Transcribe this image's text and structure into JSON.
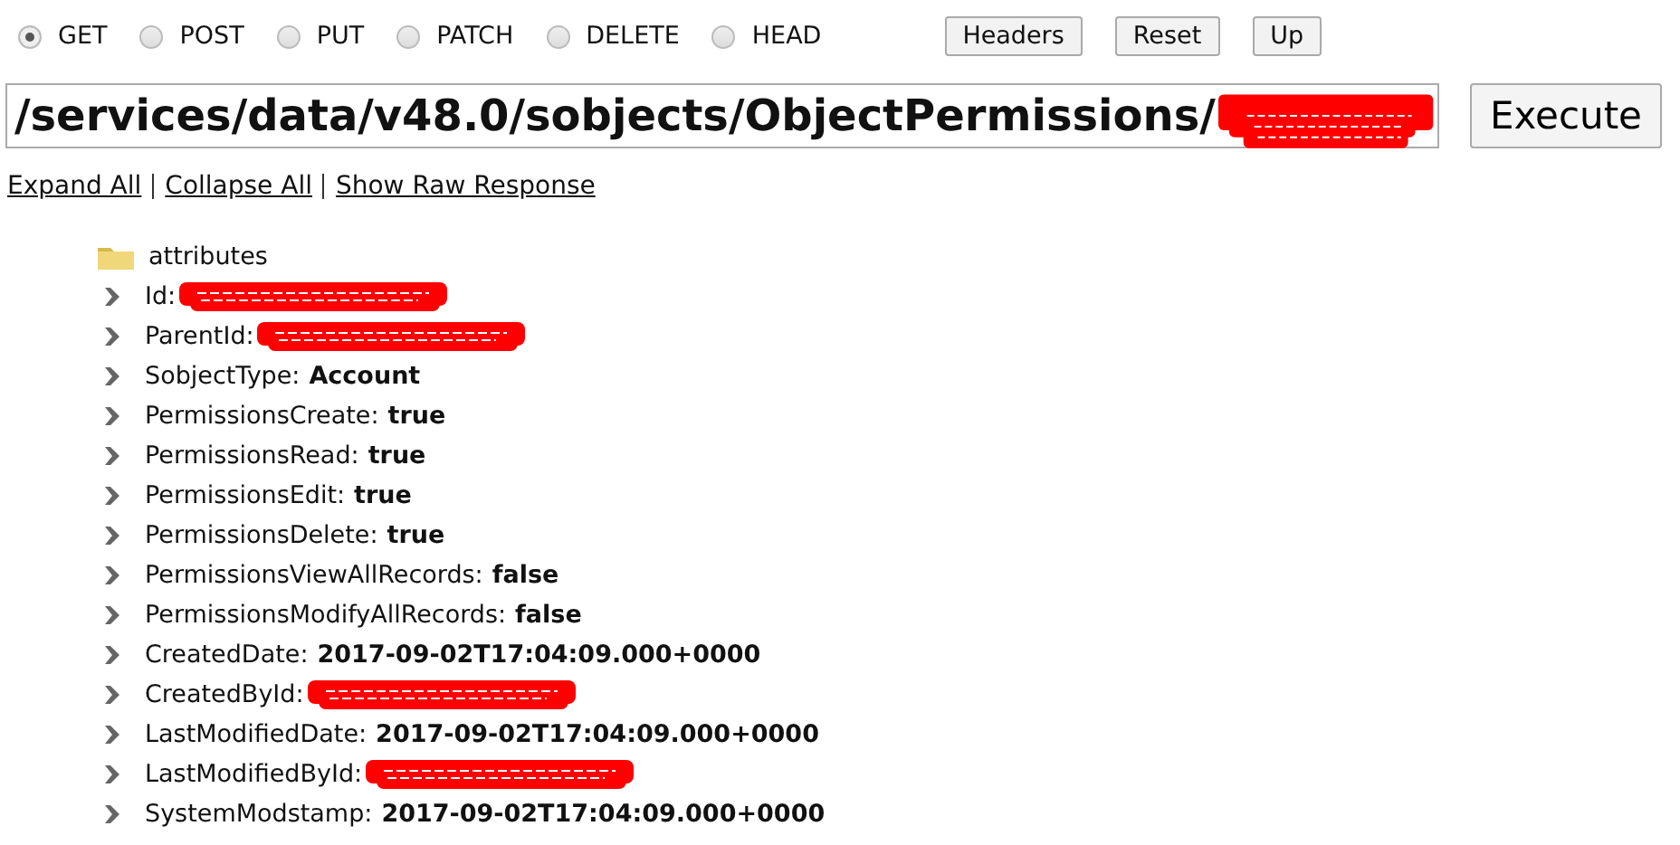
{
  "methods": [
    {
      "label": "GET",
      "selected": true
    },
    {
      "label": "POST",
      "selected": false
    },
    {
      "label": "PUT",
      "selected": false
    },
    {
      "label": "PATCH",
      "selected": false
    },
    {
      "label": "DELETE",
      "selected": false
    },
    {
      "label": "HEAD",
      "selected": false
    }
  ],
  "toolbar_buttons": [
    "Headers",
    "Reset",
    "Up"
  ],
  "url": {
    "value": "/services/data/v48.0/sobjects/ObjectPermissions/",
    "redacted": true
  },
  "execute_button": "Execute",
  "links": [
    "Expand All",
    "Collapse All",
    "Show Raw Response"
  ],
  "tree": [
    {
      "kind": "folder",
      "label": "attributes"
    },
    {
      "kind": "field",
      "label": "Id:",
      "redacted": true
    },
    {
      "kind": "field",
      "label": "ParentId:",
      "redacted": true
    },
    {
      "kind": "field",
      "label": "SobjectType:",
      "value": "Account"
    },
    {
      "kind": "field",
      "label": "PermissionsCreate:",
      "value": "true"
    },
    {
      "kind": "field",
      "label": "PermissionsRead:",
      "value": "true"
    },
    {
      "kind": "field",
      "label": "PermissionsEdit:",
      "value": "true"
    },
    {
      "kind": "field",
      "label": "PermissionsDelete:",
      "value": "true"
    },
    {
      "kind": "field",
      "label": "PermissionsViewAllRecords:",
      "value": "false"
    },
    {
      "kind": "field",
      "label": "PermissionsModifyAllRecords:",
      "value": "false"
    },
    {
      "kind": "field",
      "label": "CreatedDate:",
      "value": "2017-09-02T17:04:09.000+0000"
    },
    {
      "kind": "field",
      "label": "CreatedById:",
      "redacted": true
    },
    {
      "kind": "field",
      "label": "LastModifiedDate:",
      "value": "2017-09-02T17:04:09.000+0000"
    },
    {
      "kind": "field",
      "label": "LastModifiedById:",
      "redacted": true
    },
    {
      "kind": "field",
      "label": "SystemModstamp:",
      "value": "2017-09-02T17:04:09.000+0000"
    }
  ]
}
